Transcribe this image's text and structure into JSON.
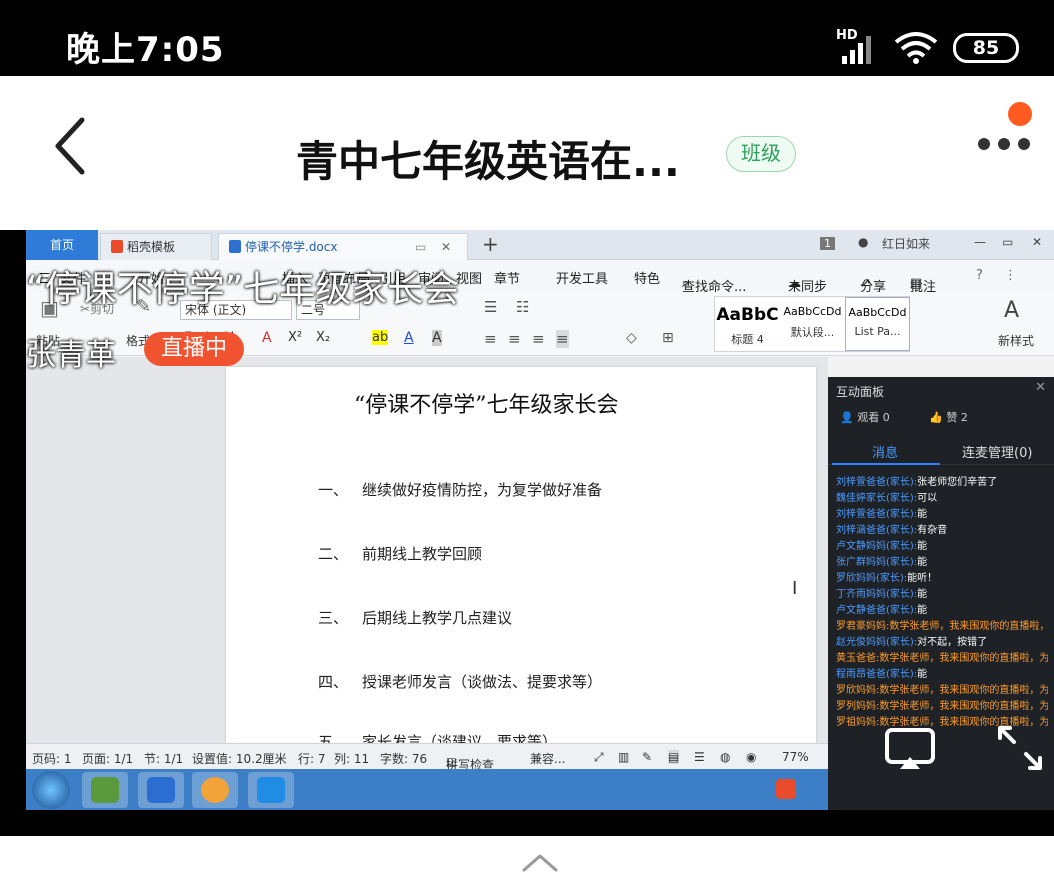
{
  "status_bar": {
    "time": "晚上7:05",
    "network": "HD",
    "battery": "85"
  },
  "header": {
    "title": "青中七年级英语在...",
    "badge": "班级"
  },
  "live": {
    "title": "“停课不停学”七年级家长会",
    "host": "张青革",
    "status": "直播中"
  },
  "wps": {
    "tabs": {
      "home": "首页",
      "template": "稻壳模板",
      "document": "停课不停学.docx"
    },
    "window_badge": "1",
    "user": "红日如来",
    "menu": [
      "三",
      "文件",
      "开始",
      "插入",
      "页面布局",
      "引用",
      "审阅",
      "视图",
      "章节",
      "开发工具",
      "特色",
      "查找命令...",
      "未同步",
      "分享",
      "批注"
    ],
    "ribbon": {
      "paste": "粘贴",
      "cut": "剪切",
      "format_painter": "格式刷",
      "font": "宋体 (正文)",
      "size": "二号",
      "styles": [
        {
          "preview": "AaBbC",
          "label": "标题 4"
        },
        {
          "preview": "AaBbCcDd",
          "label": "默认段..."
        },
        {
          "preview": "AaBbCcDd",
          "label": "List Pa..."
        }
      ],
      "new_style": "新样式"
    },
    "document": {
      "title": "“停课不停学”七年级家长会",
      "items": [
        {
          "num": "一、",
          "text": "继续做好疫情防控，为复学做好准备"
        },
        {
          "num": "二、",
          "text": "前期线上教学回顾"
        },
        {
          "num": "三、",
          "text": "后期线上教学几点建议"
        },
        {
          "num": "四、",
          "text": "授课老师发言（谈做法、提要求等）"
        },
        {
          "num": "五、",
          "text": "家长发言（谈建议、要求等）"
        }
      ]
    },
    "statusline": {
      "page": "页码: 1",
      "pages": "页面: 1/1",
      "section": "节: 1/1",
      "setting": "设置值: 10.2厘米",
      "row": "行: 7",
      "col": "列: 11",
      "words": "字数: 76",
      "spell": "拼写检查",
      "compat": "兼容...",
      "zoom": "77%"
    }
  },
  "panel": {
    "title": "互动面板",
    "viewers": "观看 0",
    "likes": "赞 2",
    "tab_messages": "消息",
    "tab_mic": "连麦管理(0)",
    "messages": [
      {
        "user": "刘梓萱爸爸(家长):",
        "text": "张老师您们辛苦了",
        "teacher": false
      },
      {
        "user": "魏佳婷家长(家长):",
        "text": "可以",
        "teacher": false
      },
      {
        "user": "刘梓萱爸爸(家长):",
        "text": "能",
        "teacher": false
      },
      {
        "user": "刘梓涵爸爸(家长):",
        "text": "有杂音",
        "teacher": false
      },
      {
        "user": "卢文静妈妈(家长):",
        "text": "能",
        "teacher": false
      },
      {
        "user": "张广群妈妈(家长):",
        "text": "能",
        "teacher": false
      },
      {
        "user": "罗欣妈妈(家长):",
        "text": "能听！",
        "teacher": false
      },
      {
        "user": "丁齐雨妈妈(家长):",
        "text": "能",
        "teacher": false
      },
      {
        "user": "卢文静爸爸(家长):",
        "text": "能",
        "teacher": false
      },
      {
        "user": "罗君豪妈妈:",
        "text": "数学张老师，我来围观你的直播啦，为你点赞！",
        "teacher": true
      },
      {
        "user": "赵光俊妈妈(家长):",
        "text": "对不起，按错了",
        "teacher": false
      },
      {
        "user": "黄玉爸爸:",
        "text": "数学张老师，我来围观你的直播啦，为你点赞！",
        "teacher": true
      },
      {
        "user": "程雨昂爸爸(家长):",
        "text": "能",
        "teacher": false
      },
      {
        "user": "罗欣妈妈:",
        "text": "数学张老师，我来围观你的直播啦，为你点赞！",
        "teacher": true
      },
      {
        "user": "罗列妈妈:",
        "text": "数学张老师，我来围观你的直播啦，为你点赞！",
        "teacher": true
      },
      {
        "user": "罗祖妈妈:",
        "text": "数学张老师，我来围观你的直播啦，为你点赞！",
        "teacher": true
      }
    ]
  },
  "colors": {
    "accent_green": "#2aa25a",
    "live_red": "#f1522f",
    "notify": "#ff5a1f",
    "wps_blue": "#2f7bd8"
  }
}
